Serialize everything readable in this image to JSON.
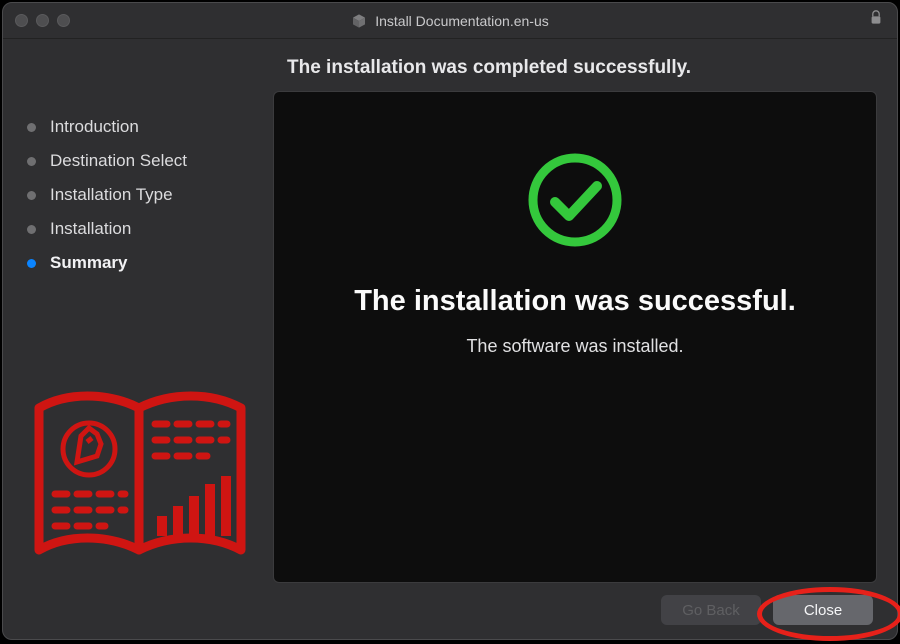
{
  "window": {
    "title": "Install Documentation.en-us"
  },
  "heading": "The installation was completed successfully.",
  "sidebar": {
    "steps": [
      {
        "label": "Introduction",
        "active": false
      },
      {
        "label": "Destination Select",
        "active": false
      },
      {
        "label": "Installation Type",
        "active": false
      },
      {
        "label": "Installation",
        "active": false
      },
      {
        "label": "Summary",
        "active": true
      }
    ]
  },
  "content": {
    "success_heading": "The installation was successful.",
    "success_sub": "The software was installed."
  },
  "footer": {
    "goback_label": "Go Back",
    "close_label": "Close"
  },
  "colors": {
    "accent_blue": "#0a84ff",
    "success_green": "#34c83c",
    "highlight_red": "#e7211a",
    "book_red": "#cf1512"
  }
}
